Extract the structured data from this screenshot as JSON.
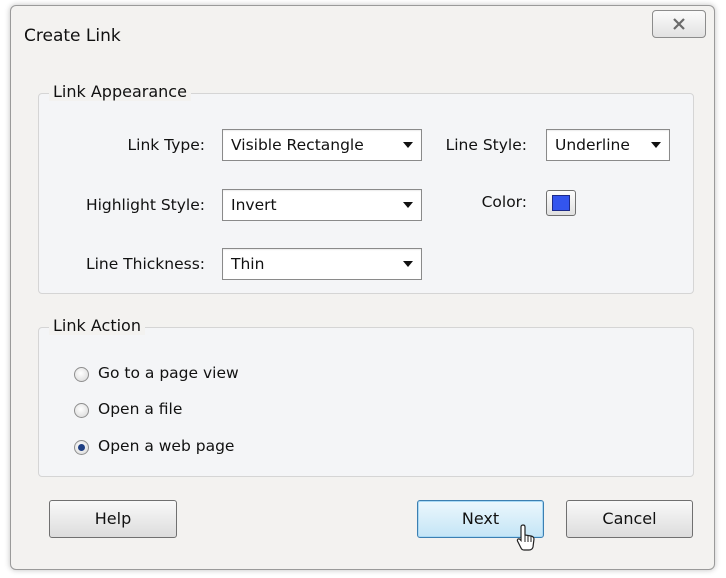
{
  "window": {
    "title": "Create Link"
  },
  "appearance": {
    "legend": "Link Appearance",
    "link_type": {
      "label": "Link Type:",
      "value": "Visible Rectangle"
    },
    "line_style": {
      "label": "Line Style:",
      "value": "Underline"
    },
    "highlight_style": {
      "label": "Highlight Style:",
      "value": "Invert"
    },
    "color": {
      "label": "Color:",
      "value": "#3355ee"
    },
    "line_thickness": {
      "label": "Line Thickness:",
      "value": "Thin"
    }
  },
  "action": {
    "legend": "Link Action",
    "options": [
      {
        "label": "Go to a page view",
        "selected": false
      },
      {
        "label": "Open a file",
        "selected": false
      },
      {
        "label": "Open a web page",
        "selected": true
      }
    ]
  },
  "buttons": {
    "help": "Help",
    "next": "Next",
    "cancel": "Cancel"
  },
  "icons": {
    "close": "close-icon",
    "dropdown": "chevron-down-icon",
    "cursor": "mouse-pointer-icon"
  }
}
